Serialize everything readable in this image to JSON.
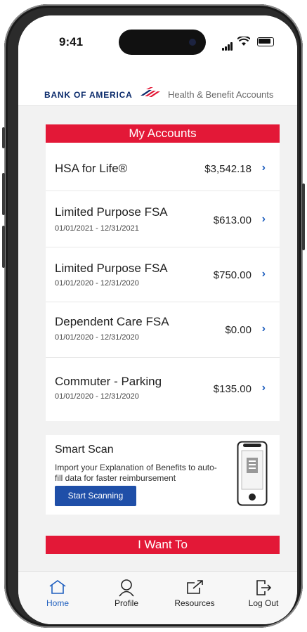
{
  "status": {
    "time": "9:41"
  },
  "header": {
    "brand": "BANK OF AMERICA",
    "subtitle": "Health & Benefit Accounts"
  },
  "accounts": {
    "title": "My Accounts",
    "items": [
      {
        "name": "HSA for Life®",
        "dates": "",
        "amount": "$3,542.18"
      },
      {
        "name": "Limited Purpose FSA",
        "dates": "01/01/2021 - 12/31/2021",
        "amount": "$613.00"
      },
      {
        "name": "Limited Purpose FSA",
        "dates": "01/01/2020 - 12/31/2020",
        "amount": "$750.00"
      },
      {
        "name": "Dependent Care FSA",
        "dates": "01/01/2020 - 12/31/2020",
        "amount": "$0.00"
      },
      {
        "name": "Commuter - Parking",
        "dates": "01/01/2020 - 12/31/2020",
        "amount": "$135.00"
      }
    ]
  },
  "smart_scan": {
    "title": "Smart Scan",
    "description": "Import your Explanation of Benefits to auto-fill data for faster reimbursement",
    "button": "Start Scanning"
  },
  "want": {
    "title": "I Want To"
  },
  "tabs": [
    {
      "label": "Home",
      "icon": "home-icon",
      "active": true
    },
    {
      "label": "Profile",
      "icon": "profile-icon",
      "active": false
    },
    {
      "label": "Resources",
      "icon": "external-link-icon",
      "active": false
    },
    {
      "label": "Log Out",
      "icon": "logout-icon",
      "active": false
    }
  ],
  "colors": {
    "brand_red": "#e31837",
    "brand_blue": "#0a2a6b",
    "accent_blue": "#1f5fbf",
    "button_blue": "#1f4fa8"
  }
}
